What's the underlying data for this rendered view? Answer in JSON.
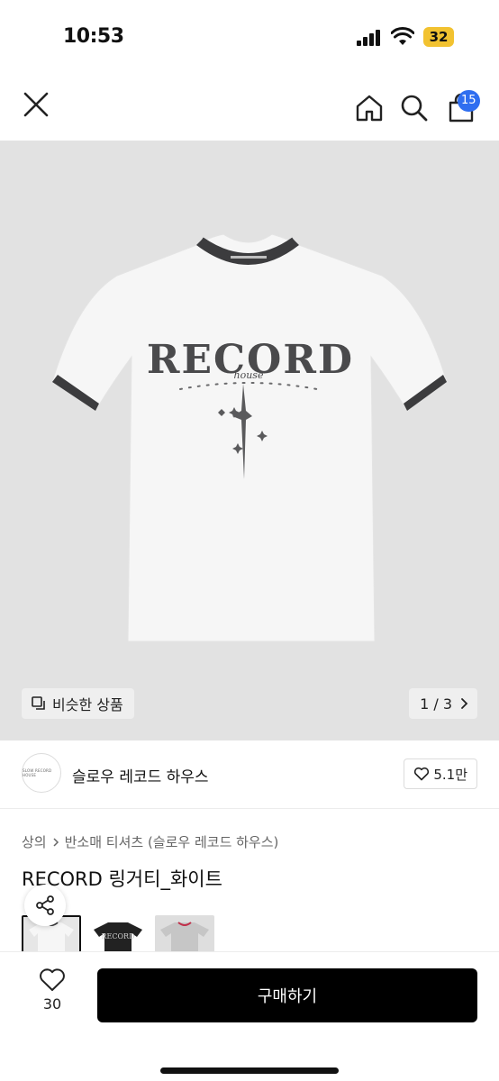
{
  "status_bar": {
    "time": "10:53",
    "battery": "32",
    "colors": {
      "battery": "#f2c230"
    }
  },
  "header": {
    "icons": [
      "close-icon",
      "home-icon",
      "search-icon",
      "bag-icon"
    ],
    "cart_badge": "15",
    "colors": {
      "badge": "#2f6ef0"
    }
  },
  "gallery": {
    "similar_label": "비슷한 상품",
    "page_indicator": "1 / 3",
    "shirt_print": {
      "main": "RECORD",
      "sub": "house"
    },
    "colors": {
      "background": "#e2e2e2",
      "shirt": "#f6f6f6",
      "trim": "#3c3c3e"
    }
  },
  "brand": {
    "name": "슬로우 레코드 하우스",
    "logo_text": "SLOW RECORD HOUSE",
    "likes": "5.1만"
  },
  "product": {
    "breadcrumb": [
      "상의",
      "반소매 티셔츠 (슬로우 레코드 하우스)"
    ],
    "title": "RECORD 링거티_화이트",
    "color_options": [
      {
        "name": "white",
        "selected": true,
        "shirt": "#f6f6f6",
        "trim": "#3c3c3e"
      },
      {
        "name": "black",
        "selected": false,
        "shirt": "#222222",
        "trim": "#111111"
      },
      {
        "name": "gray",
        "selected": false,
        "shirt": "#c6c6c6",
        "trim": "#c0304a"
      }
    ]
  },
  "bottom_bar": {
    "wish_count": "30",
    "buy_label": "구매하기"
  }
}
